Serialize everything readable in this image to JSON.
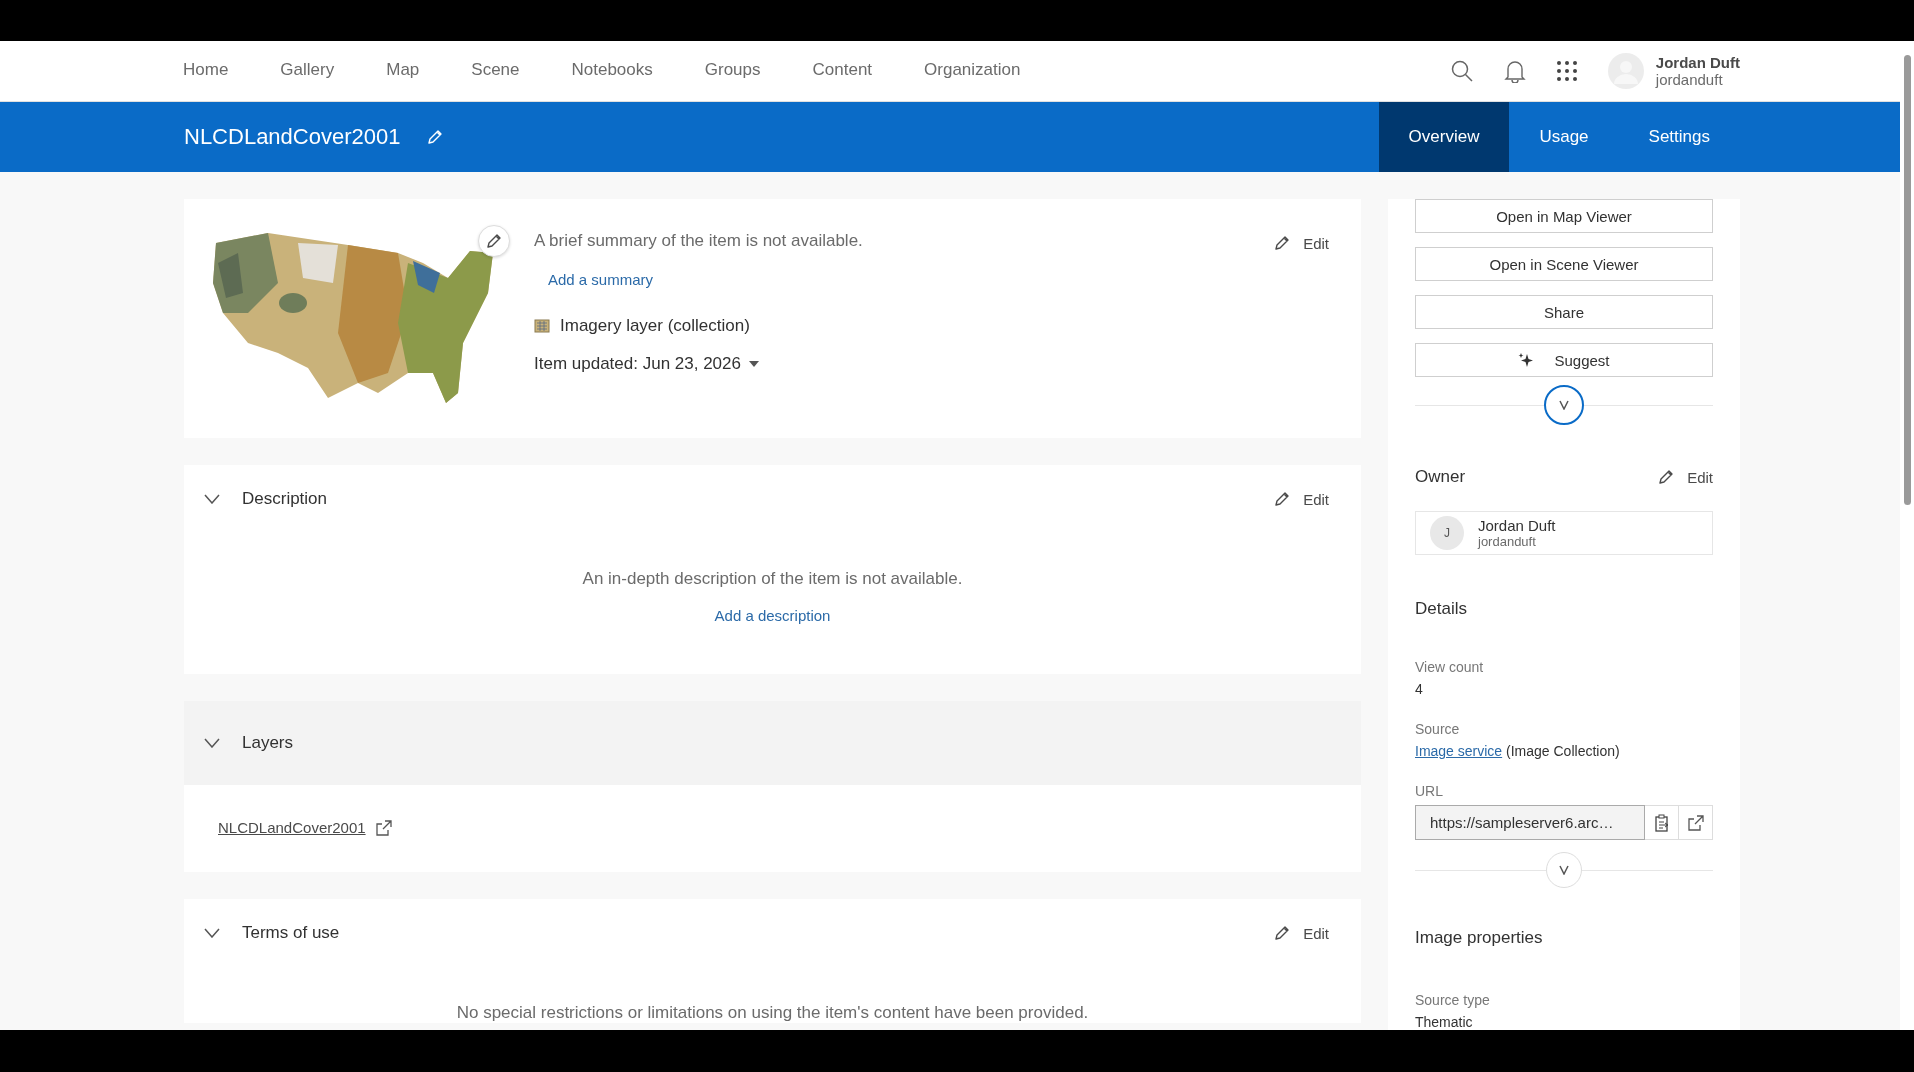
{
  "nav": {
    "items": [
      {
        "label": "Home",
        "selected": false
      },
      {
        "label": "Gallery",
        "selected": false
      },
      {
        "label": "Map",
        "selected": false
      },
      {
        "label": "Scene",
        "selected": false
      },
      {
        "label": "Notebooks",
        "selected": false
      },
      {
        "label": "Groups",
        "selected": false
      },
      {
        "label": "Content",
        "selected": false
      },
      {
        "label": "Organization",
        "selected": false
      }
    ],
    "user": {
      "name": "Jordan Duft",
      "username": "jordanduft"
    }
  },
  "header": {
    "title": "NLCDLandCover2001",
    "tabs": [
      {
        "label": "Overview",
        "selected": true
      },
      {
        "label": "Usage",
        "selected": false
      },
      {
        "label": "Settings",
        "selected": false
      }
    ]
  },
  "summary_card": {
    "summary": "A brief summary of the item is not available.",
    "add_link": "Add a summary",
    "edit": "Edit",
    "item_type": "Imagery layer (collection)",
    "updated": "Item updated: Jun 23, 2026"
  },
  "sections": [
    {
      "kind": "description",
      "title": "Description",
      "edit": "Edit",
      "message": "An in-depth description of the item is not available.",
      "link": "Add a description"
    },
    {
      "kind": "layers",
      "title": "Layers",
      "layers": [
        "NLCDLandCover2001"
      ]
    },
    {
      "kind": "terms",
      "title": "Terms of use",
      "edit": "Edit",
      "message": "No special restrictions or limitations on using the item's content have been provided."
    }
  ],
  "sidebar": {
    "buttons": [
      {
        "label": "Open in Map Viewer",
        "kind": "plain"
      },
      {
        "label": "Open in Scene Viewer",
        "kind": "plain"
      },
      {
        "label": "Share",
        "kind": "plain"
      },
      {
        "label": "Suggest",
        "kind": "sparkle"
      }
    ],
    "owner": {
      "title": "Owner",
      "edit": "Edit",
      "initial": "J",
      "name": "Jordan Duft",
      "username": "jordanduft"
    },
    "details": {
      "title": "Details",
      "fields": [
        {
          "kind": "text",
          "label": "View count",
          "value": "4"
        },
        {
          "kind": "link",
          "label": "Source",
          "link": "Image service",
          "value": "(Image Collection)"
        },
        {
          "kind": "url",
          "label": "URL",
          "value": "https://sampleserver6.arc…"
        }
      ]
    },
    "image_properties": {
      "title": "Image properties",
      "fields": [
        {
          "kind": "text",
          "label": "Source type",
          "value": "Thematic"
        }
      ]
    }
  }
}
